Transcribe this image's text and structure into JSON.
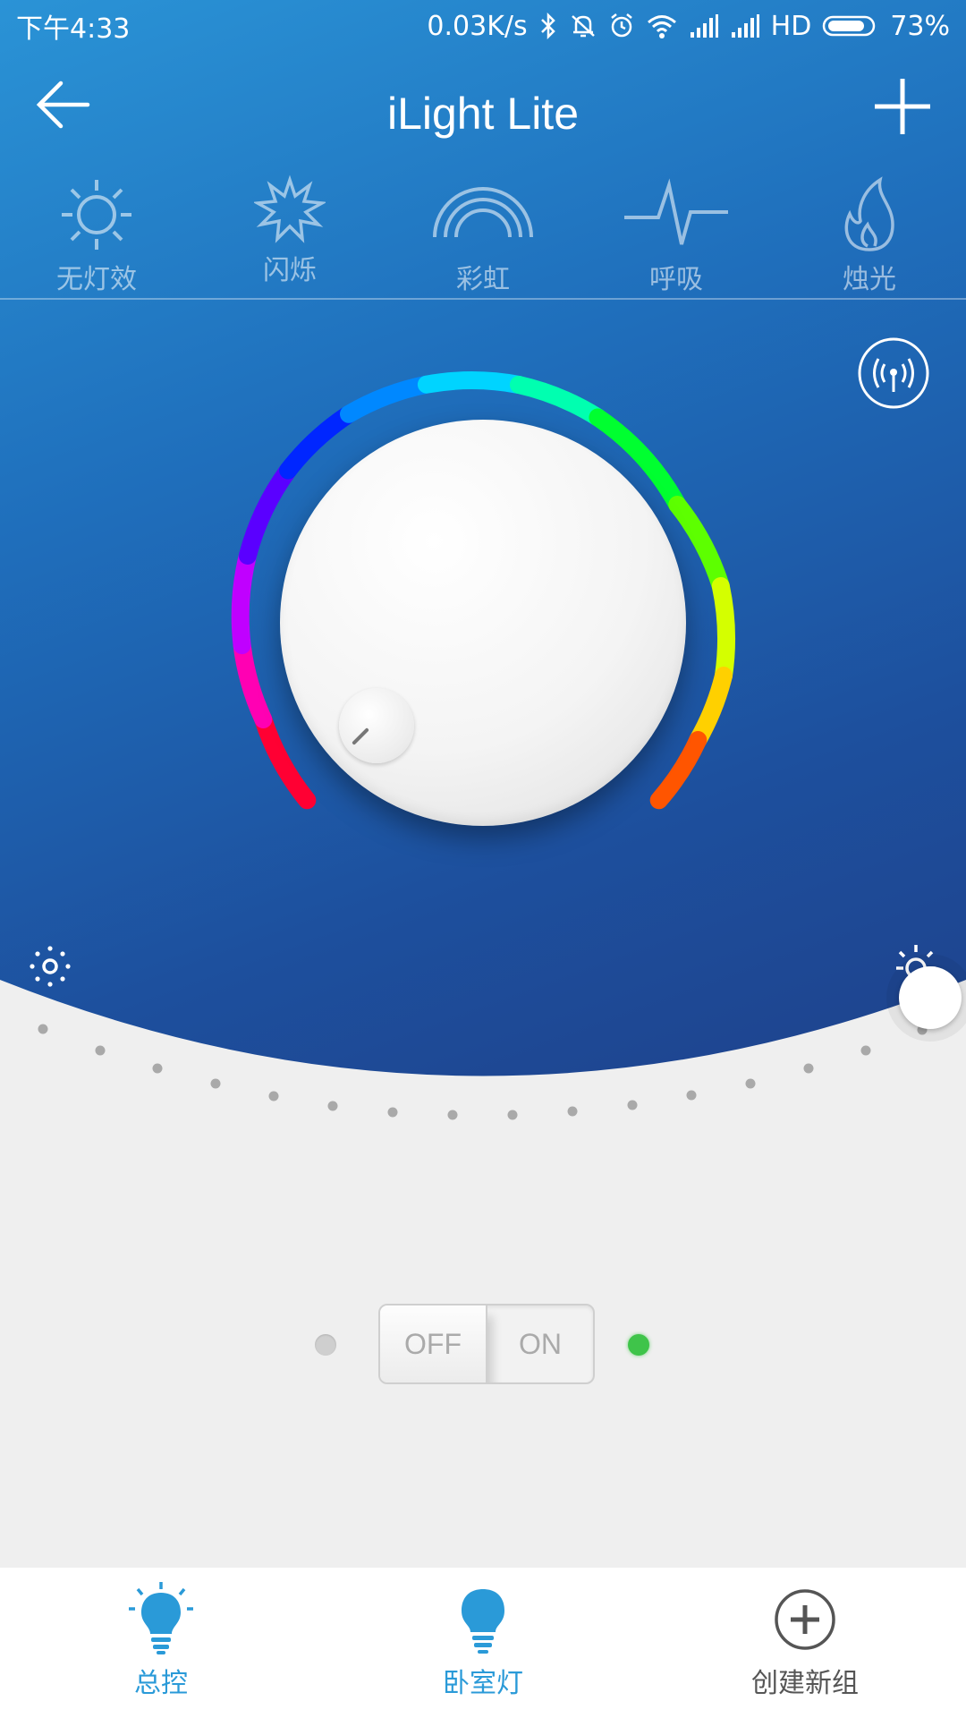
{
  "status_bar": {
    "time": "下午4:33",
    "speed": "0.03K/s",
    "network": "HD",
    "battery": "73%"
  },
  "app_bar": {
    "title": "iLight Lite",
    "back_icon": "arrow-left-icon",
    "add_icon": "plus-icon"
  },
  "effects": [
    {
      "label": "无灯效",
      "icon": "sun-icon"
    },
    {
      "label": "闪烁",
      "icon": "starburst-icon"
    },
    {
      "label": "彩虹",
      "icon": "rainbow-icon"
    },
    {
      "label": "呼吸",
      "icon": "pulse-icon"
    },
    {
      "label": "烛光",
      "icon": "flame-icon"
    }
  ],
  "brightness": {
    "level": 1.0
  },
  "power_switch": {
    "off_label": "OFF",
    "on_label": "ON",
    "state": "on"
  },
  "bottom_nav": [
    {
      "label": "总控",
      "icon": "bulb-icon"
    },
    {
      "label": "卧室灯",
      "icon": "bulb-icon"
    },
    {
      "label": "创建新组",
      "icon": "add-circle-icon"
    }
  ],
  "colors": {
    "accent_blue": "#2a9ad8",
    "led_on": "#3fc44a"
  }
}
